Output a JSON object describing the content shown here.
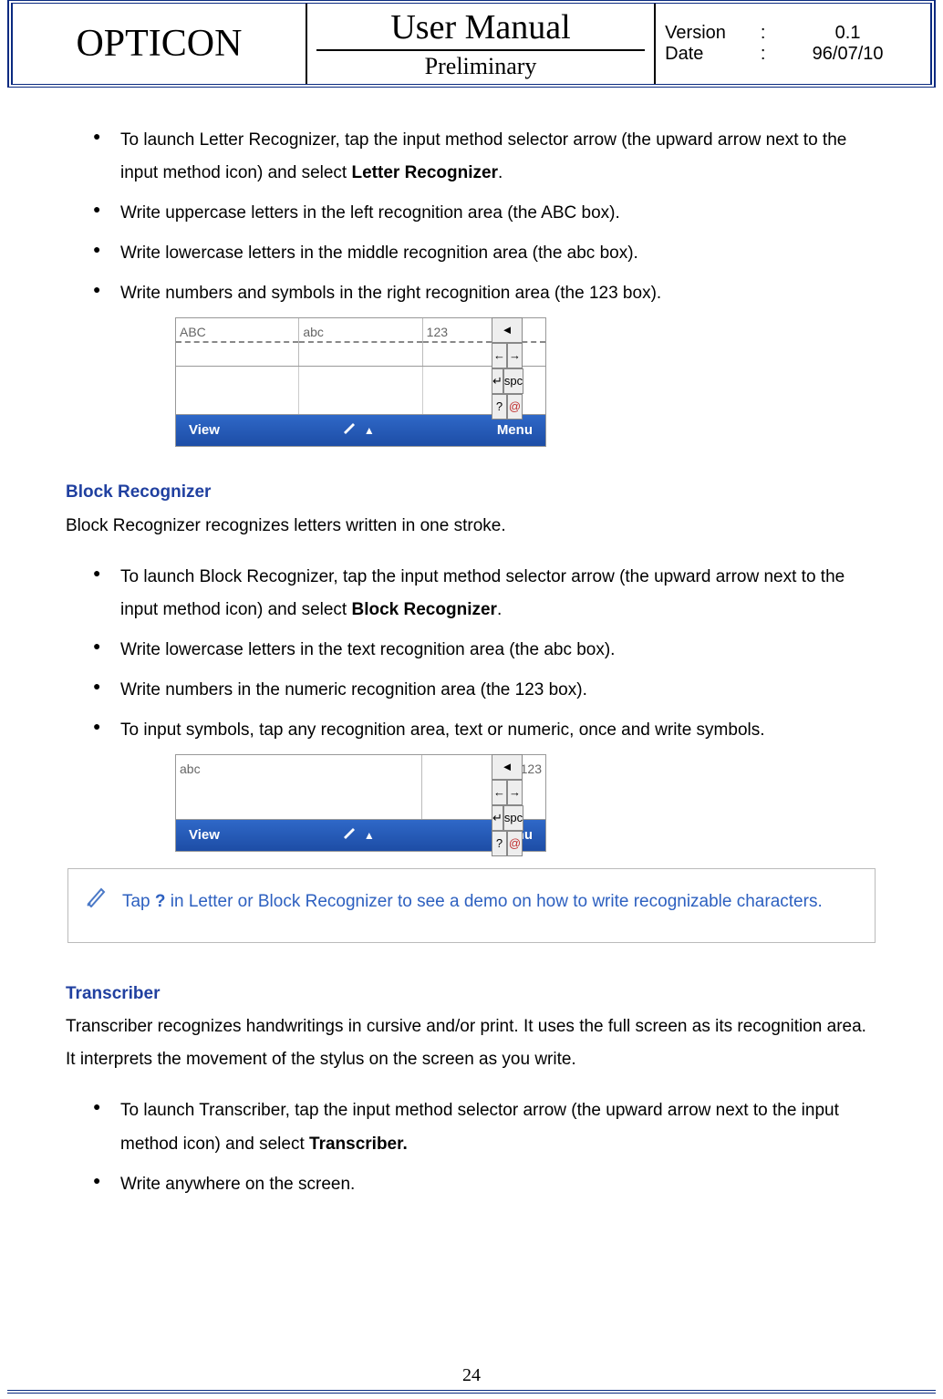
{
  "header": {
    "brand": "OPTICON",
    "title": "User Manual",
    "subtitle": "Preliminary",
    "rows": [
      {
        "label": "Version",
        "sep": ":",
        "value": "0.1"
      },
      {
        "label": "Date",
        "sep": ":",
        "value": "96/07/10"
      }
    ]
  },
  "letter": {
    "items": [
      {
        "pre": "To launch Letter Recognizer, tap the input method selector arrow (the upward arrow next to the input method icon) and select ",
        "bold": "Letter Recognizer",
        "post": "."
      },
      {
        "text": "Write uppercase letters in the left recognition area (the ABC box)."
      },
      {
        "text": "Write lowercase letters in the middle recognition area (the abc box)."
      },
      {
        "text": "Write numbers and symbols in the right recognition area (the 123 box)."
      }
    ],
    "panel": {
      "areas": [
        "ABC",
        "abc",
        "123"
      ],
      "side": [
        "◄",
        "←",
        "→",
        "↵",
        "spc",
        "?",
        "@"
      ],
      "bar": {
        "left": "View",
        "right": "Menu"
      }
    }
  },
  "block": {
    "heading": "Block Recognizer",
    "intro": "Block Recognizer recognizes letters written in one stroke.",
    "items": [
      {
        "pre": "To launch Block Recognizer, tap the input method selector arrow (the upward arrow next to the input method icon) and select ",
        "bold": "Block Recognizer",
        "post": "."
      },
      {
        "text": "Write lowercase letters in the text recognition area (the abc box)."
      },
      {
        "text": "Write numbers in the numeric recognition area (the 123 box)."
      },
      {
        "text": "To input symbols, tap any recognition area, text or numeric, once and write symbols."
      }
    ],
    "panel": {
      "areas": [
        "abc",
        "123"
      ],
      "side": [
        "◄",
        "←",
        "→",
        "↵",
        "spc",
        "?",
        "@"
      ],
      "bar": {
        "left": "View",
        "right": "Menu"
      }
    }
  },
  "note": {
    "pre": "Tap ",
    "q": "?",
    "post": " in Letter or Block Recognizer to see a demo on how to write recognizable characters."
  },
  "transcriber": {
    "heading": "Transcriber",
    "intro": "Transcriber recognizes handwritings in cursive and/or print. It uses the full screen as its recognition area. It interprets the movement of the stylus on the screen as you write.",
    "items": [
      {
        "pre": "To launch Transcriber, tap the input method selector arrow (the upward arrow next to the input method icon) and select ",
        "bold": "Transcriber.",
        "post": ""
      },
      {
        "text": "Write anywhere on the screen."
      }
    ]
  },
  "pagenum": "24"
}
